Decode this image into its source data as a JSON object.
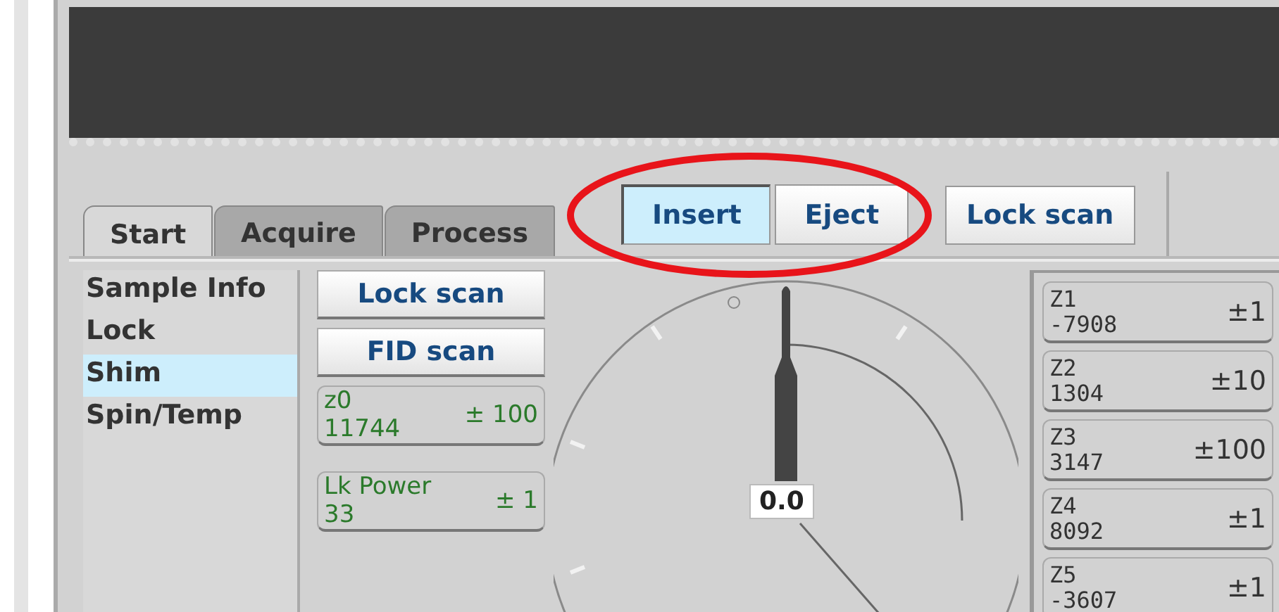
{
  "tabs": [
    {
      "label": "Start",
      "selected": true
    },
    {
      "label": "Acquire",
      "selected": false
    },
    {
      "label": "Process",
      "selected": false
    }
  ],
  "sample_buttons": [
    {
      "label": "Insert",
      "selected": true
    },
    {
      "label": "Eject",
      "selected": false
    }
  ],
  "lock_scan_button": "Lock scan",
  "annotation": {
    "kind": "ellipse"
  },
  "sidebar": {
    "items": [
      {
        "label": "Sample Info",
        "selected": false
      },
      {
        "label": "Lock",
        "selected": false
      },
      {
        "label": "Shim",
        "selected": true
      },
      {
        "label": "Spin/Temp",
        "selected": false
      }
    ]
  },
  "scan_buttons": [
    "Lock scan",
    "FID scan"
  ],
  "controls": [
    {
      "name": "z0",
      "value": "11744",
      "step": "± 100"
    },
    {
      "name": "Lk Power",
      "value": "33",
      "step": "± 1"
    }
  ],
  "dial": {
    "reading": "0.0"
  },
  "shims": [
    {
      "name": "Z1",
      "value": "-7908",
      "step": "±1"
    },
    {
      "name": "Z2",
      "value": "1304",
      "step": "±10"
    },
    {
      "name": "Z3",
      "value": "3147",
      "step": "±100"
    },
    {
      "name": "Z4",
      "value": "8092",
      "step": "±1"
    },
    {
      "name": "Z5",
      "value": "-3607",
      "step": "±1"
    }
  ]
}
